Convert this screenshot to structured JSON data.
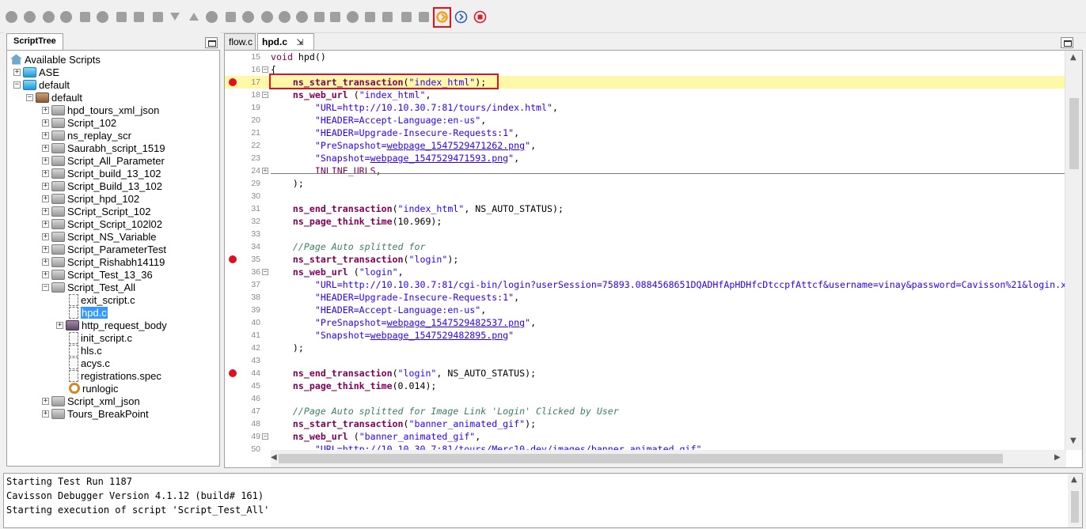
{
  "toolbar": {
    "buttons": [
      "record-icon",
      "stop-icon",
      "no-entry-icon",
      "pause-icon",
      "step-icon",
      "comment-icon",
      "comment-icon",
      "save-icon",
      "copy-icon",
      "download-icon",
      "upload-icon",
      "settings-icon",
      "edit-icon",
      "brush-icon",
      "gear-icon",
      "wrench-icon",
      "bullet-icon",
      "box-icon",
      "card-icon",
      "disc-icon",
      "gauge-icon",
      "person-icon",
      "house-icon",
      "floppy-icon",
      "refresh-icon",
      "next-icon",
      "stop-circle-icon"
    ]
  },
  "script_tree": {
    "tab_label": "ScriptTree",
    "nodes": [
      {
        "label": "Available Scripts"
      },
      {
        "label": "ASE"
      },
      {
        "label": "default"
      },
      {
        "label": "default"
      },
      {
        "label": "hpd_tours_xml_json"
      },
      {
        "label": "Script_102"
      },
      {
        "label": "ns_replay_scr"
      },
      {
        "label": "Saurabh_script_1519"
      },
      {
        "label": "Script_All_Parameter"
      },
      {
        "label": "Script_build_13_102"
      },
      {
        "label": "Script_Build_13_102"
      },
      {
        "label": "Script_hpd_102"
      },
      {
        "label": "SCript_Script_102"
      },
      {
        "label": "Script_Script_102l02"
      },
      {
        "label": "Script_NS_Variable"
      },
      {
        "label": "Script_ParameterTest"
      },
      {
        "label": "Script_Rishabh14119"
      },
      {
        "label": "Script_Test_13_36"
      },
      {
        "label": "Script_Test_All"
      },
      {
        "label": "exit_script.c"
      },
      {
        "label": "hpd.c"
      },
      {
        "label": "http_request_body"
      },
      {
        "label": "init_script.c"
      },
      {
        "label": "hls.c"
      },
      {
        "label": "acys.c"
      },
      {
        "label": "registrations.spec"
      },
      {
        "label": "runlogic"
      },
      {
        "label": "Script_xml_json"
      },
      {
        "label": "Tours_BreakPoint"
      }
    ]
  },
  "editor": {
    "tabs": [
      {
        "label": "flow.c"
      },
      {
        "label": "hpd.c"
      }
    ],
    "pin_glyph": "⇲",
    "close_glyph": "✕",
    "lines": [
      {
        "n": "15",
        "tokens": [
          {
            "t": "void ",
            "c": "kw"
          },
          {
            "t": "hpd",
            "c": "plain"
          },
          {
            "t": "()",
            "c": "plain"
          }
        ]
      },
      {
        "n": "16",
        "tokens": [
          {
            "t": "{",
            "c": "plain"
          }
        ]
      },
      {
        "n": "17",
        "tokens": [
          {
            "t": "    ",
            "c": "plain"
          },
          {
            "t": "ns_start_transaction",
            "c": "fn"
          },
          {
            "t": "(",
            "c": "plain"
          },
          {
            "t": "\"index_html\"",
            "c": "str"
          },
          {
            "t": ");",
            "c": "plain"
          }
        ]
      },
      {
        "n": "18",
        "tokens": [
          {
            "t": "    ",
            "c": "plain"
          },
          {
            "t": "ns_web_url",
            "c": "fn"
          },
          {
            "t": " (",
            "c": "plain"
          },
          {
            "t": "\"index_html\"",
            "c": "str"
          },
          {
            "t": ",",
            "c": "plain"
          }
        ]
      },
      {
        "n": "19",
        "tokens": [
          {
            "t": "        ",
            "c": "plain"
          },
          {
            "t": "\"URL=http://10.10.30.7:81/tours/index.html\"",
            "c": "str"
          },
          {
            "t": ",",
            "c": "plain"
          }
        ]
      },
      {
        "n": "20",
        "tokens": [
          {
            "t": "        ",
            "c": "plain"
          },
          {
            "t": "\"HEADER=Accept-Language:en-us\"",
            "c": "str"
          },
          {
            "t": ",",
            "c": "plain"
          }
        ]
      },
      {
        "n": "21",
        "tokens": [
          {
            "t": "        ",
            "c": "plain"
          },
          {
            "t": "\"HEADER=Upgrade-Insecure-Requests:1\"",
            "c": "str"
          },
          {
            "t": ",",
            "c": "plain"
          }
        ]
      },
      {
        "n": "22",
        "tokens": [
          {
            "t": "        ",
            "c": "plain"
          },
          {
            "t": "\"PreSnapshot=",
            "c": "str"
          },
          {
            "t": "webpage_1547529471262.png",
            "c": "link"
          },
          {
            "t": "\"",
            "c": "str"
          },
          {
            "t": ",",
            "c": "plain"
          }
        ]
      },
      {
        "n": "23",
        "tokens": [
          {
            "t": "        ",
            "c": "plain"
          },
          {
            "t": "\"Snapshot=",
            "c": "str"
          },
          {
            "t": "webpage_1547529471593.png",
            "c": "link"
          },
          {
            "t": "\"",
            "c": "str"
          },
          {
            "t": ",",
            "c": "plain"
          }
        ]
      },
      {
        "n": "24",
        "tokens": [
          {
            "t": "        ",
            "c": "plain"
          },
          {
            "t": "INLINE_URLS",
            "c": "kw"
          },
          {
            "t": ",",
            "c": "plain"
          }
        ]
      },
      {
        "n": "29",
        "tokens": [
          {
            "t": "    );",
            "c": "plain"
          }
        ]
      },
      {
        "n": "30",
        "tokens": []
      },
      {
        "n": "31",
        "tokens": [
          {
            "t": "    ",
            "c": "plain"
          },
          {
            "t": "ns_end_transaction",
            "c": "fn"
          },
          {
            "t": "(",
            "c": "plain"
          },
          {
            "t": "\"index_html\"",
            "c": "str"
          },
          {
            "t": ", NS_AUTO_STATUS);",
            "c": "plain"
          }
        ]
      },
      {
        "n": "32",
        "tokens": [
          {
            "t": "    ",
            "c": "plain"
          },
          {
            "t": "ns_page_think_time",
            "c": "fn"
          },
          {
            "t": "(10.969);",
            "c": "plain"
          }
        ]
      },
      {
        "n": "33",
        "tokens": []
      },
      {
        "n": "34",
        "tokens": [
          {
            "t": "    ",
            "c": "plain"
          },
          {
            "t": "//Page Auto splitted for",
            "c": "cm"
          }
        ]
      },
      {
        "n": "35",
        "tokens": [
          {
            "t": "    ",
            "c": "plain"
          },
          {
            "t": "ns_start_transaction",
            "c": "fn"
          },
          {
            "t": "(",
            "c": "plain"
          },
          {
            "t": "\"login\"",
            "c": "str"
          },
          {
            "t": ");",
            "c": "plain"
          }
        ]
      },
      {
        "n": "36",
        "tokens": [
          {
            "t": "    ",
            "c": "plain"
          },
          {
            "t": "ns_web_url",
            "c": "fn"
          },
          {
            "t": " (",
            "c": "plain"
          },
          {
            "t": "\"login\"",
            "c": "str"
          },
          {
            "t": ",",
            "c": "plain"
          }
        ]
      },
      {
        "n": "37",
        "tokens": [
          {
            "t": "        ",
            "c": "plain"
          },
          {
            "t": "\"URL=http://10.10.30.7:81/cgi-bin/login?userSession=75893.0884568651DQADHfApHDHfcDtccpfAttcf&username=vinay&password=Cavisson%21&login.x",
            "c": "str"
          }
        ]
      },
      {
        "n": "38",
        "tokens": [
          {
            "t": "        ",
            "c": "plain"
          },
          {
            "t": "\"HEADER=Upgrade-Insecure-Requests:1\"",
            "c": "str"
          },
          {
            "t": ",",
            "c": "plain"
          }
        ]
      },
      {
        "n": "39",
        "tokens": [
          {
            "t": "        ",
            "c": "plain"
          },
          {
            "t": "\"HEADER=Accept-Language:en-us\"",
            "c": "str"
          },
          {
            "t": ",",
            "c": "plain"
          }
        ]
      },
      {
        "n": "40",
        "tokens": [
          {
            "t": "        ",
            "c": "plain"
          },
          {
            "t": "\"PreSnapshot=",
            "c": "str"
          },
          {
            "t": "webpage_1547529482537.png",
            "c": "link"
          },
          {
            "t": "\"",
            "c": "str"
          },
          {
            "t": ",",
            "c": "plain"
          }
        ]
      },
      {
        "n": "41",
        "tokens": [
          {
            "t": "        ",
            "c": "plain"
          },
          {
            "t": "\"Snapshot=",
            "c": "str"
          },
          {
            "t": "webpage_1547529482895.png",
            "c": "link"
          },
          {
            "t": "\"",
            "c": "str"
          }
        ]
      },
      {
        "n": "42",
        "tokens": [
          {
            "t": "    );",
            "c": "plain"
          }
        ]
      },
      {
        "n": "43",
        "tokens": []
      },
      {
        "n": "44",
        "tokens": [
          {
            "t": "    ",
            "c": "plain"
          },
          {
            "t": "ns_end_transaction",
            "c": "fn"
          },
          {
            "t": "(",
            "c": "plain"
          },
          {
            "t": "\"login\"",
            "c": "str"
          },
          {
            "t": ", NS_AUTO_STATUS);",
            "c": "plain"
          }
        ]
      },
      {
        "n": "45",
        "tokens": [
          {
            "t": "    ",
            "c": "plain"
          },
          {
            "t": "ns_page_think_time",
            "c": "fn"
          },
          {
            "t": "(0.014);",
            "c": "plain"
          }
        ]
      },
      {
        "n": "46",
        "tokens": []
      },
      {
        "n": "47",
        "tokens": [
          {
            "t": "    ",
            "c": "plain"
          },
          {
            "t": "//Page Auto splitted for Image Link 'Login' Clicked by User",
            "c": "cm"
          }
        ]
      },
      {
        "n": "48",
        "tokens": [
          {
            "t": "    ",
            "c": "plain"
          },
          {
            "t": "ns_start_transaction",
            "c": "fn"
          },
          {
            "t": "(",
            "c": "plain"
          },
          {
            "t": "\"banner_animated_gif\"",
            "c": "str"
          },
          {
            "t": ");",
            "c": "plain"
          }
        ]
      },
      {
        "n": "49",
        "tokens": [
          {
            "t": "    ",
            "c": "plain"
          },
          {
            "t": "ns_web_url",
            "c": "fn"
          },
          {
            "t": " (",
            "c": "plain"
          },
          {
            "t": "\"banner_animated_gif\"",
            "c": "str"
          },
          {
            "t": ",",
            "c": "plain"
          }
        ]
      },
      {
        "n": "50",
        "tokens": [
          {
            "t": "        ",
            "c": "plain"
          },
          {
            "t": "\"URL=http://10.10.30.7:81/tours/Merc10-dev/images/banner_animated.gif\"",
            "c": "str"
          },
          {
            "t": ",",
            "c": "plain"
          }
        ]
      }
    ]
  },
  "console": {
    "lines": [
      "Starting Test Run 1187",
      "Cavisson Debugger Version 4.1.12 (build# 161)",
      "Starting execution of script 'Script_Test_All'"
    ]
  }
}
